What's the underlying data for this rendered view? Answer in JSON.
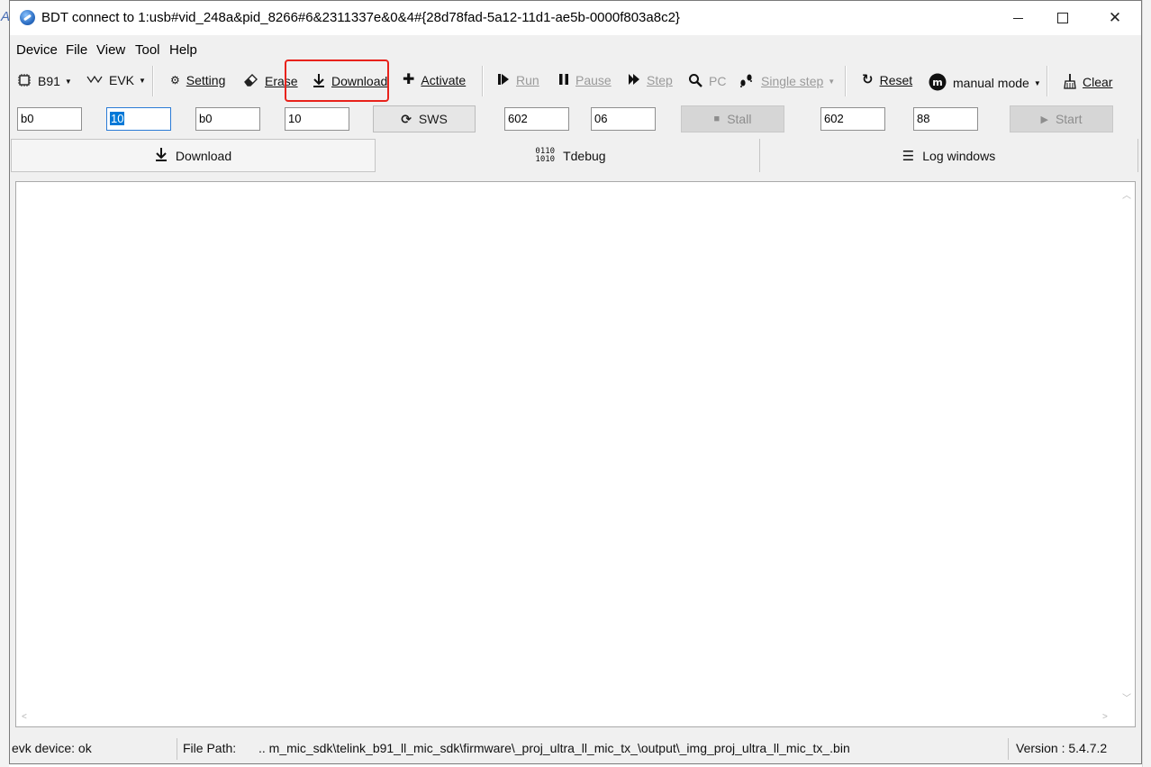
{
  "window": {
    "title": "BDT connect to 1:usb#vid_248a&pid_8266#6&2311337e&0&4#{28d78fad-5a12-11d1-ae5b-0000f803a8c2}",
    "background_left_glyph": "A"
  },
  "menu": [
    "Device",
    "File",
    "View",
    "Tool",
    "Help"
  ],
  "toolbar": {
    "chip": "B91",
    "evk": "EVK",
    "setting": "Setting",
    "erase": "Erase",
    "download": "Download",
    "activate": "Activate",
    "run": "Run",
    "pause": "Pause",
    "step": "Step",
    "pc": "PC",
    "single_step": "Single step",
    "reset": "Reset",
    "manual_mode": "manual mode",
    "clear": "Clear"
  },
  "fields": {
    "f1": "b0",
    "f2": "10",
    "f3": "b0",
    "f4": "10",
    "sws_button": "SWS",
    "f5": "602",
    "f6": "06",
    "stall_button": "Stall",
    "f7": "602",
    "f8": "88",
    "start_button": "Start"
  },
  "tabs": [
    "Download",
    "Tdebug",
    "Log windows"
  ],
  "status": {
    "device": "evk device: ok",
    "file_path_label": "File Path:",
    "file_path_value": "..  m_mic_sdk\\telink_b91_ll_mic_sdk\\firmware\\_proj_ultra_ll_mic_tx_\\output\\_img_proj_ultra_ll_mic_tx_.bin",
    "version": "Version : 5.4.7.2"
  },
  "colors": {
    "highlight": "#e8221b",
    "selection": "#0078d7",
    "window_bg": "#f0f0f0"
  },
  "icons": {
    "app": "bdt-app-icon",
    "chip": "chip-icon",
    "evk": "signal-wave-icon",
    "setting": "gear-icon",
    "erase": "eraser-icon",
    "download": "download-arrow-icon",
    "activate": "plus-icon",
    "run": "run-icon",
    "pause": "pause-icon",
    "step": "step-icon",
    "pc": "magnifier-icon",
    "single_step": "footprints-icon",
    "reset": "reset-icon",
    "manual_mode": "manual-mode-icon",
    "clear": "broom-icon",
    "sws": "refresh-icon",
    "stall": "stop-square-icon",
    "start": "play-icon",
    "tdebug": "binary-grid-icon",
    "log": "list-icon"
  }
}
